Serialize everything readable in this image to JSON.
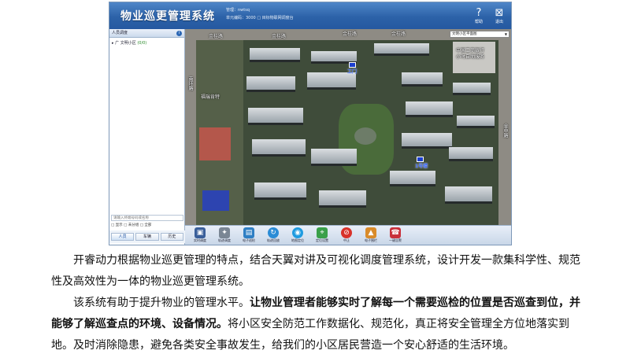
{
  "app": {
    "title": "物业巡更管理系统",
    "info_line1": "管理：nwtsq",
    "info_line2": "单元编码：3000   □ 目标物联网调度台",
    "help_label": "帮助",
    "exit_label": "退出"
  },
  "left_panel": {
    "header": "人员调度",
    "tree_prefix": "▸ 广",
    "tree_name": "文明小区",
    "tree_count": "(0/0)",
    "search_placeholder": "请输入终端号码或名称",
    "options": "□ 显示   □ 未分组  □ 全部",
    "tabs": [
      "人员",
      "车辆",
      "历史"
    ]
  },
  "map": {
    "select_value": "文明小区平面图",
    "road_labels": [
      "金桂路",
      "金桂路",
      "金桂路",
      "金桂路",
      "南环路",
      "金中路"
    ],
    "place_labels": [
      "中国工商银行",
      "小时自助服务",
      "福瑞肯特"
    ],
    "markers": [
      "工门",
      "1号楼"
    ]
  },
  "toolbar": {
    "tools": [
      {
        "icon": "realtime-icon",
        "label": "实时调度"
      },
      {
        "icon": "dispatch-icon",
        "label": "轨迹调度"
      },
      {
        "icon": "check-icon",
        "label": "电子巡检"
      },
      {
        "icon": "trail-icon",
        "label": "轨迹回放"
      },
      {
        "icon": "map-icon",
        "label": "地图定位"
      },
      {
        "icon": "point-icon",
        "label": "定位设置"
      },
      {
        "icon": "stop-icon",
        "label": "中止"
      },
      {
        "icon": "fence-icon",
        "label": "电子围栏"
      },
      {
        "icon": "alarm-icon",
        "label": "一键告警"
      }
    ]
  },
  "caption": {
    "p1": "开睿动力根据物业巡更管理的特点，结合天翼对讲及可视化调度管理系统，设计开发一款集科学性、规范性及高效性为一体的物业巡更管理系统。",
    "p2_normal_a": "该系统有助于提升物业的管理水平。",
    "p2_bold": "让物业管理者能够实时了解每一个需要巡检的位置是否巡查到位，并能够了解巡查点的环境、设备情况。",
    "p2_normal_b": "将小区安全防范工作数据化、规范化，真正将安全管理全方位地落实到地。及时消除隐患，避免各类安全事故发生，给我们的小区居民营造一个安心舒适的生活环境。"
  },
  "colors": {
    "titlebar": "#2c62a8",
    "accent": "#1b3fd0"
  }
}
